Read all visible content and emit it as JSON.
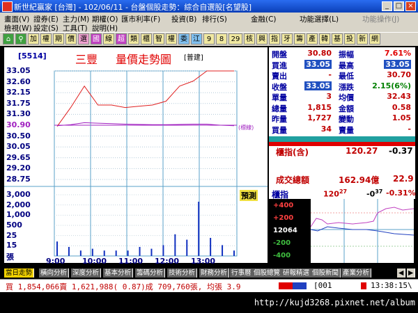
{
  "window": {
    "title": "新世紀贏家 [台灣] - 102/06/11 - 台盤個股走勢：綜合自選股[名望股]",
    "buttons": {
      "min": "_",
      "max": "□",
      "close": "×"
    }
  },
  "menus": {
    "row1": [
      "畫面(V)",
      "證券(E)",
      "主力(M)",
      "期權(O)",
      "匯市利率(F)",
      "投資(B)",
      "排行(S)",
      "金融(C)",
      "功能選擇(L)",
      "功能操作(J)"
    ],
    "row2": [
      "檢視(W)",
      "設定(S)",
      "工具(T)",
      "說明(H)"
    ]
  },
  "toolbar": {
    "items": [
      "加",
      "權",
      "期",
      "價",
      "選",
      "國",
      "線",
      "超",
      "類",
      "櫃",
      "智",
      "權",
      "委",
      "江",
      "9",
      "8",
      "29",
      "核",
      "興",
      "指",
      "牙",
      "籌",
      "產",
      "韓",
      "基",
      "投",
      "新",
      "網"
    ]
  },
  "chart": {
    "code": "[5514]",
    "name": "三豐",
    "title": "量價走勢圖",
    "tag": "[普建]",
    "annotation_ref": "(標線)",
    "forecast_button": "預測",
    "y_ticks": [
      "33.05",
      "32.60",
      "32.15",
      "31.75",
      "31.30",
      "30.90",
      "30.50",
      "30.05",
      "29.65",
      "29.20",
      "28.75"
    ],
    "ref_price": "30.90",
    "vol_ticks": [
      "3,000",
      "2,000",
      "1,000",
      "500",
      "25",
      "15",
      "張"
    ],
    "x_ticks": [
      "9:00",
      "10:00",
      "11:00",
      "12:00",
      "13:00"
    ],
    "colors": {
      "price": "#e02020",
      "avg": "#a020c0",
      "volume": "#1030c0",
      "grid": "#5aa0c8"
    }
  },
  "chart_data": {
    "type": "line",
    "x": [
      "9:00",
      "9:10",
      "9:20",
      "9:30",
      "10:00",
      "10:30",
      "11:00",
      "11:30",
      "12:00",
      "12:15",
      "12:30",
      "12:45",
      "13:00",
      "13:30"
    ],
    "series": [
      {
        "values": [
          30.85,
          31.6,
          32.45,
          31.7,
          31.7,
          31.6,
          31.65,
          31.7,
          31.85,
          32.45,
          32.65,
          33.05,
          33.05,
          33.05
        ]
      },
      {
        "values": [
          30.88,
          30.92,
          31.0,
          30.98,
          30.96,
          30.94,
          30.93,
          30.92,
          30.92,
          30.93,
          30.94,
          30.94,
          30.9,
          30.88
        ]
      }
    ],
    "volume": [
      8,
      5,
      3,
      4,
      3,
      3,
      3,
      5,
      4,
      6,
      12,
      9,
      30,
      10,
      6,
      3
    ],
    "ylim": [
      28.75,
      33.05
    ]
  },
  "quote": {
    "rows": [
      {
        "l1": "開盤",
        "v1": "30.80",
        "l2": "振幅",
        "v2": "7.61%",
        "c2": "#e00000"
      },
      {
        "l1": "買進",
        "v1": "33.05",
        "h1": true,
        "l2": "最高",
        "v2": "33.05",
        "h2": true
      },
      {
        "l1": "賣出",
        "v1": "-",
        "l2": "最低",
        "v2": "30.70"
      },
      {
        "l1": "收盤",
        "v1": "33.05",
        "h1": true,
        "l2": "漲跌",
        "v2": "2.15(6%)",
        "c2": "#008000"
      },
      {
        "l1": "單量",
        "v1": "3",
        "l2": "均價",
        "v2": "32.43"
      },
      {
        "l1": "總量",
        "v1": "1,815",
        "l2": "金額",
        "v2": "0.58"
      },
      {
        "l1": "昨量",
        "v1": "1,727",
        "l2": "變動",
        "v2": "1.05"
      },
      {
        "l1": "買量",
        "v1": "34",
        "l2": "賣量",
        "v2": "-"
      }
    ]
  },
  "index_box": {
    "label": "櫃指(含)",
    "value": "120.27",
    "change": "-0.37",
    "amount_label": "成交總額",
    "amount": "162.94億",
    "amount2": "22.9"
  },
  "mini_chart": {
    "label": "櫃指",
    "value": "120",
    "value_sup": "27",
    "change": "-0",
    "change_sup": "37",
    "pct": "-0.31%",
    "ticks": [
      "+400",
      "+200",
      "12064",
      "-200",
      "-400"
    ]
  },
  "tabs": [
    "當日走勢",
    "橫向分析",
    "深度分析",
    "基本分析",
    "籌碼分析",
    "技術分析",
    "財務分析",
    "行事曆",
    "個股總覽",
    "研報精選",
    "個股新聞",
    "產業分析"
  ],
  "status": {
    "text": "買 1,854,066賣 1,621,988( 0.87)成 709,760張, 均張 3.9",
    "code": "001",
    "time": "13:38:15"
  },
  "footer": {
    "url": "http://kujd3268.pixnet.net/album"
  }
}
